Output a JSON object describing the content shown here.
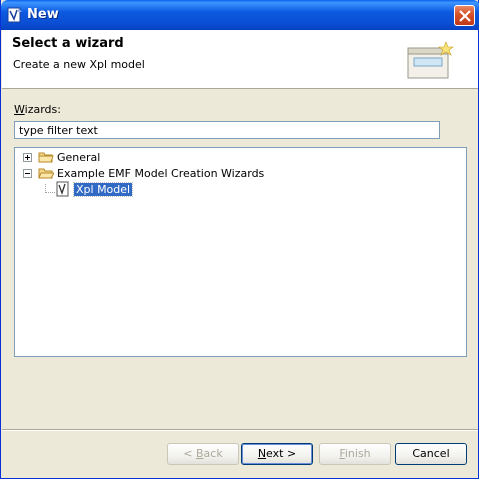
{
  "window": {
    "title": "New"
  },
  "banner": {
    "title": "Select a wizard",
    "description": "Create a new Xpl model"
  },
  "wizards": {
    "label_prefix": "",
    "label_accel": "W",
    "label_rest": "izards:",
    "filter_value": "type filter text"
  },
  "tree": {
    "items": [
      {
        "label": "General",
        "expanded": false
      },
      {
        "label": "Example EMF Model Creation Wizards",
        "expanded": true
      },
      {
        "label": "Xpl Model",
        "selected": true
      }
    ]
  },
  "buttons": {
    "back": {
      "prefix": "< ",
      "accel": "B",
      "rest": "ack",
      "enabled": false
    },
    "next": {
      "accel": "N",
      "rest": "ext >",
      "enabled": true
    },
    "finish": {
      "accel": "F",
      "rest": "inish",
      "enabled": false
    },
    "cancel": {
      "label": "Cancel",
      "enabled": true
    }
  },
  "colors": {
    "title_bar": "#0a4fd4",
    "selection": "#316ac5",
    "dialog_bg": "#ece9d8"
  }
}
